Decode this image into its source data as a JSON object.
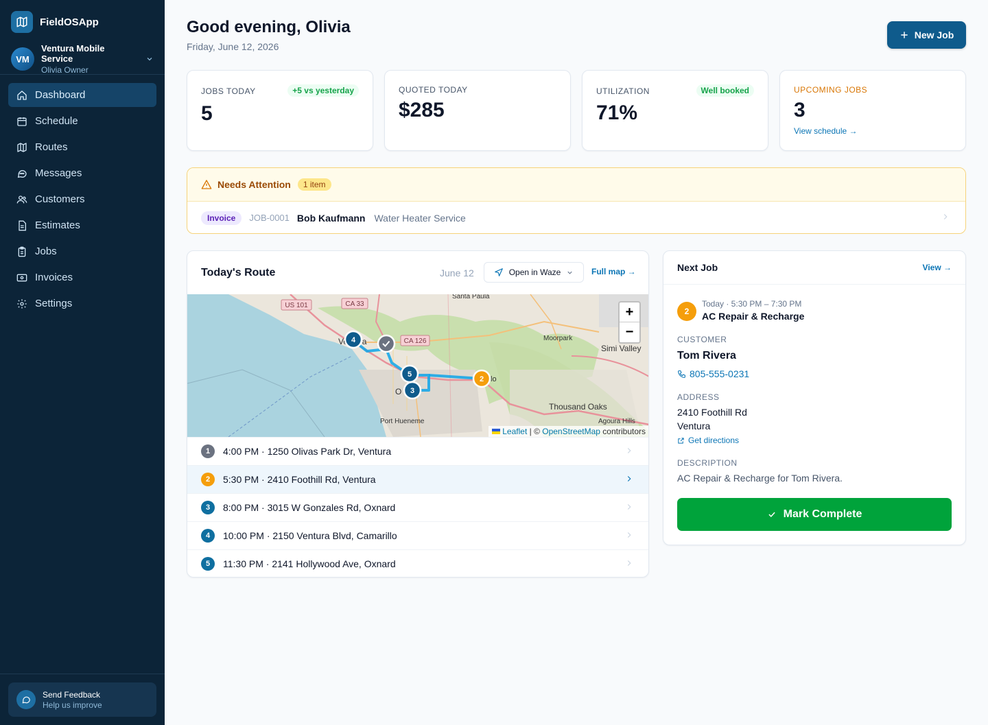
{
  "app": {
    "name": "FieldOSApp"
  },
  "org": {
    "initials": "VM",
    "name": "Ventura Mobile Service",
    "user": "Olivia Owner"
  },
  "nav": [
    {
      "label": "Dashboard",
      "icon": "home-icon",
      "active": true
    },
    {
      "label": "Schedule",
      "icon": "calendar-icon"
    },
    {
      "label": "Routes",
      "icon": "map-icon"
    },
    {
      "label": "Messages",
      "icon": "message-icon"
    },
    {
      "label": "Customers",
      "icon": "users-icon"
    },
    {
      "label": "Estimates",
      "icon": "document-icon"
    },
    {
      "label": "Jobs",
      "icon": "clipboard-icon"
    },
    {
      "label": "Invoices",
      "icon": "invoice-icon"
    },
    {
      "label": "Settings",
      "icon": "gear-icon"
    }
  ],
  "feedback": {
    "title": "Send Feedback",
    "subtitle": "Help us improve"
  },
  "header": {
    "greeting": "Good evening, Olivia",
    "date": "Friday, June 12, 2026",
    "new_job": "New Job"
  },
  "stats": {
    "jobs_today": {
      "label": "JOBS TODAY",
      "value": "5",
      "badge": "+5 vs yesterday"
    },
    "quoted_today": {
      "label": "QUOTED TODAY",
      "value": "$285"
    },
    "utilization": {
      "label": "UTILIZATION",
      "value": "71%",
      "badge": "Well booked"
    },
    "upcoming": {
      "label": "UPCOMING JOBS",
      "value": "3",
      "link": "View schedule →"
    }
  },
  "attention": {
    "title": "Needs Attention",
    "count": "1 item",
    "item": {
      "type": "Invoice",
      "job_id": "JOB-0001",
      "customer": "Bob Kaufmann",
      "service": "Water Heater Service"
    }
  },
  "route": {
    "title": "Today's Route",
    "date": "June 12",
    "waze": "Open in Waze",
    "full_map": "Full map →",
    "map_labels": {
      "us101": "US 101",
      "ca33": "CA 33",
      "ca126": "CA 126",
      "santa_paula": "Santa Paula",
      "moorpark": "Moorpark",
      "simi_valley": "Simi Valley",
      "thousand_oaks": "Thousand Oaks",
      "port_hueneme": "Port Hueneme",
      "agoura_hills": "Agoura Hills",
      "ventura": "Ventura",
      "oxnard": "O",
      "camarillo": "lo"
    },
    "zoom_in": "+",
    "zoom_out": "−",
    "attribution": {
      "leaflet": "Leaflet",
      "sep": " | © ",
      "osm": "OpenStreetMap",
      "contributors": " contributors"
    },
    "stops": [
      {
        "num": "1",
        "text": "4:00 PM · 1250 Olivas Park Dr, Ventura",
        "color": "#6b7280"
      },
      {
        "num": "2",
        "text": "5:30 PM · 2410 Foothill Rd, Ventura",
        "color": "#f59e0b",
        "active": true
      },
      {
        "num": "3",
        "text": "8:00 PM · 3015 W Gonzales Rd, Oxnard",
        "color": "#0f6fa0"
      },
      {
        "num": "4",
        "text": "10:00 PM · 2150 Ventura Blvd, Camarillo",
        "color": "#0f6fa0"
      },
      {
        "num": "5",
        "text": "11:30 PM · 2141 Hollywood Ave, Oxnard",
        "color": "#0f6fa0"
      }
    ]
  },
  "next_job": {
    "title": "Next Job",
    "view": "View →",
    "num": "2",
    "time": "Today · 5:30 PM – 7:30 PM",
    "service": "AC Repair & Recharge",
    "customer_label": "CUSTOMER",
    "customer": "Tom Rivera",
    "phone": "805-555-0231",
    "address_label": "ADDRESS",
    "address_line1": "2410 Foothill Rd",
    "address_line2": "Ventura",
    "directions": "Get directions",
    "description_label": "DESCRIPTION",
    "description": "AC Repair & Recharge for Tom Rivera.",
    "mark_complete": "Mark Complete"
  }
}
